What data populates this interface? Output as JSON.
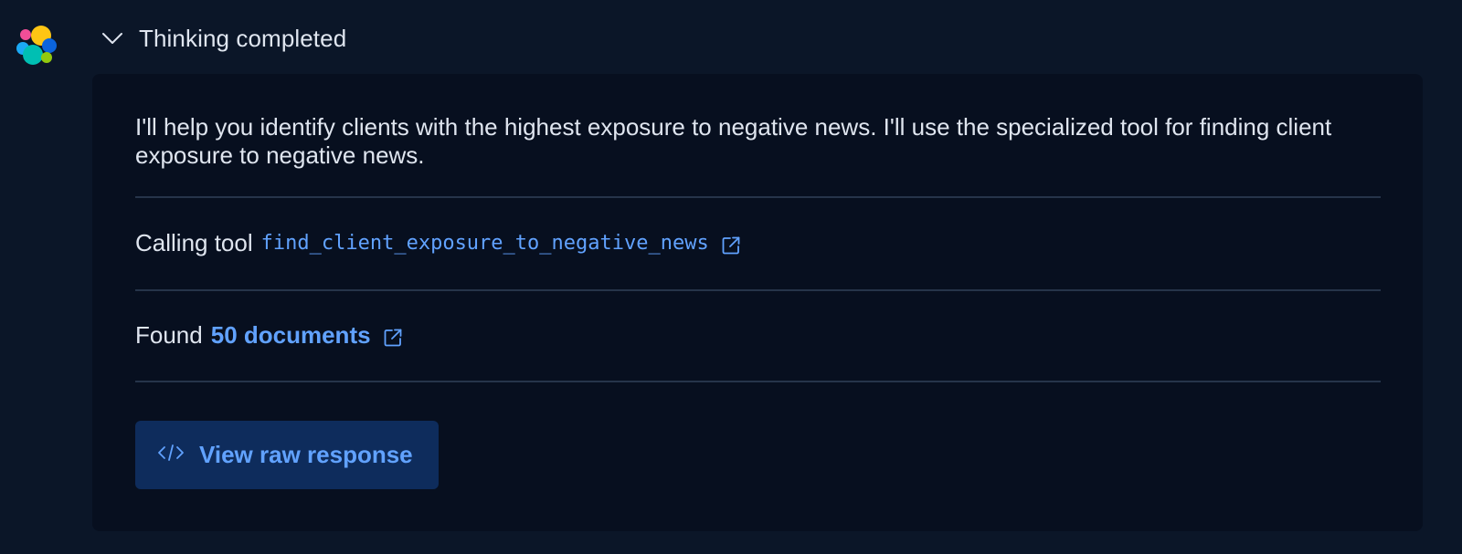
{
  "header": {
    "title": "Thinking completed",
    "avatar_icon": "elastic-logo-icon",
    "toggle_icon": "chevron-down-icon"
  },
  "panel": {
    "intro_text": "I'll help you identify clients with the highest exposure to negative news. I'll use the specialized tool for finding client exposure to negative news.",
    "tool_call": {
      "prefix": "Calling tool",
      "tool_name": "find_client_exposure_to_negative_news",
      "link_icon": "external-link-icon"
    },
    "result": {
      "prefix": "Found",
      "link_text": "50 documents",
      "link_icon": "external-link-icon"
    },
    "raw_button": {
      "label": "View raw response",
      "icon": "code-icon"
    }
  },
  "colors": {
    "background": "#0b1628",
    "panel": "#070f1f",
    "accent": "#61a2ff",
    "button_bg": "#0e2c5c",
    "divider": "#26344a",
    "text": "#dfe5ef"
  }
}
